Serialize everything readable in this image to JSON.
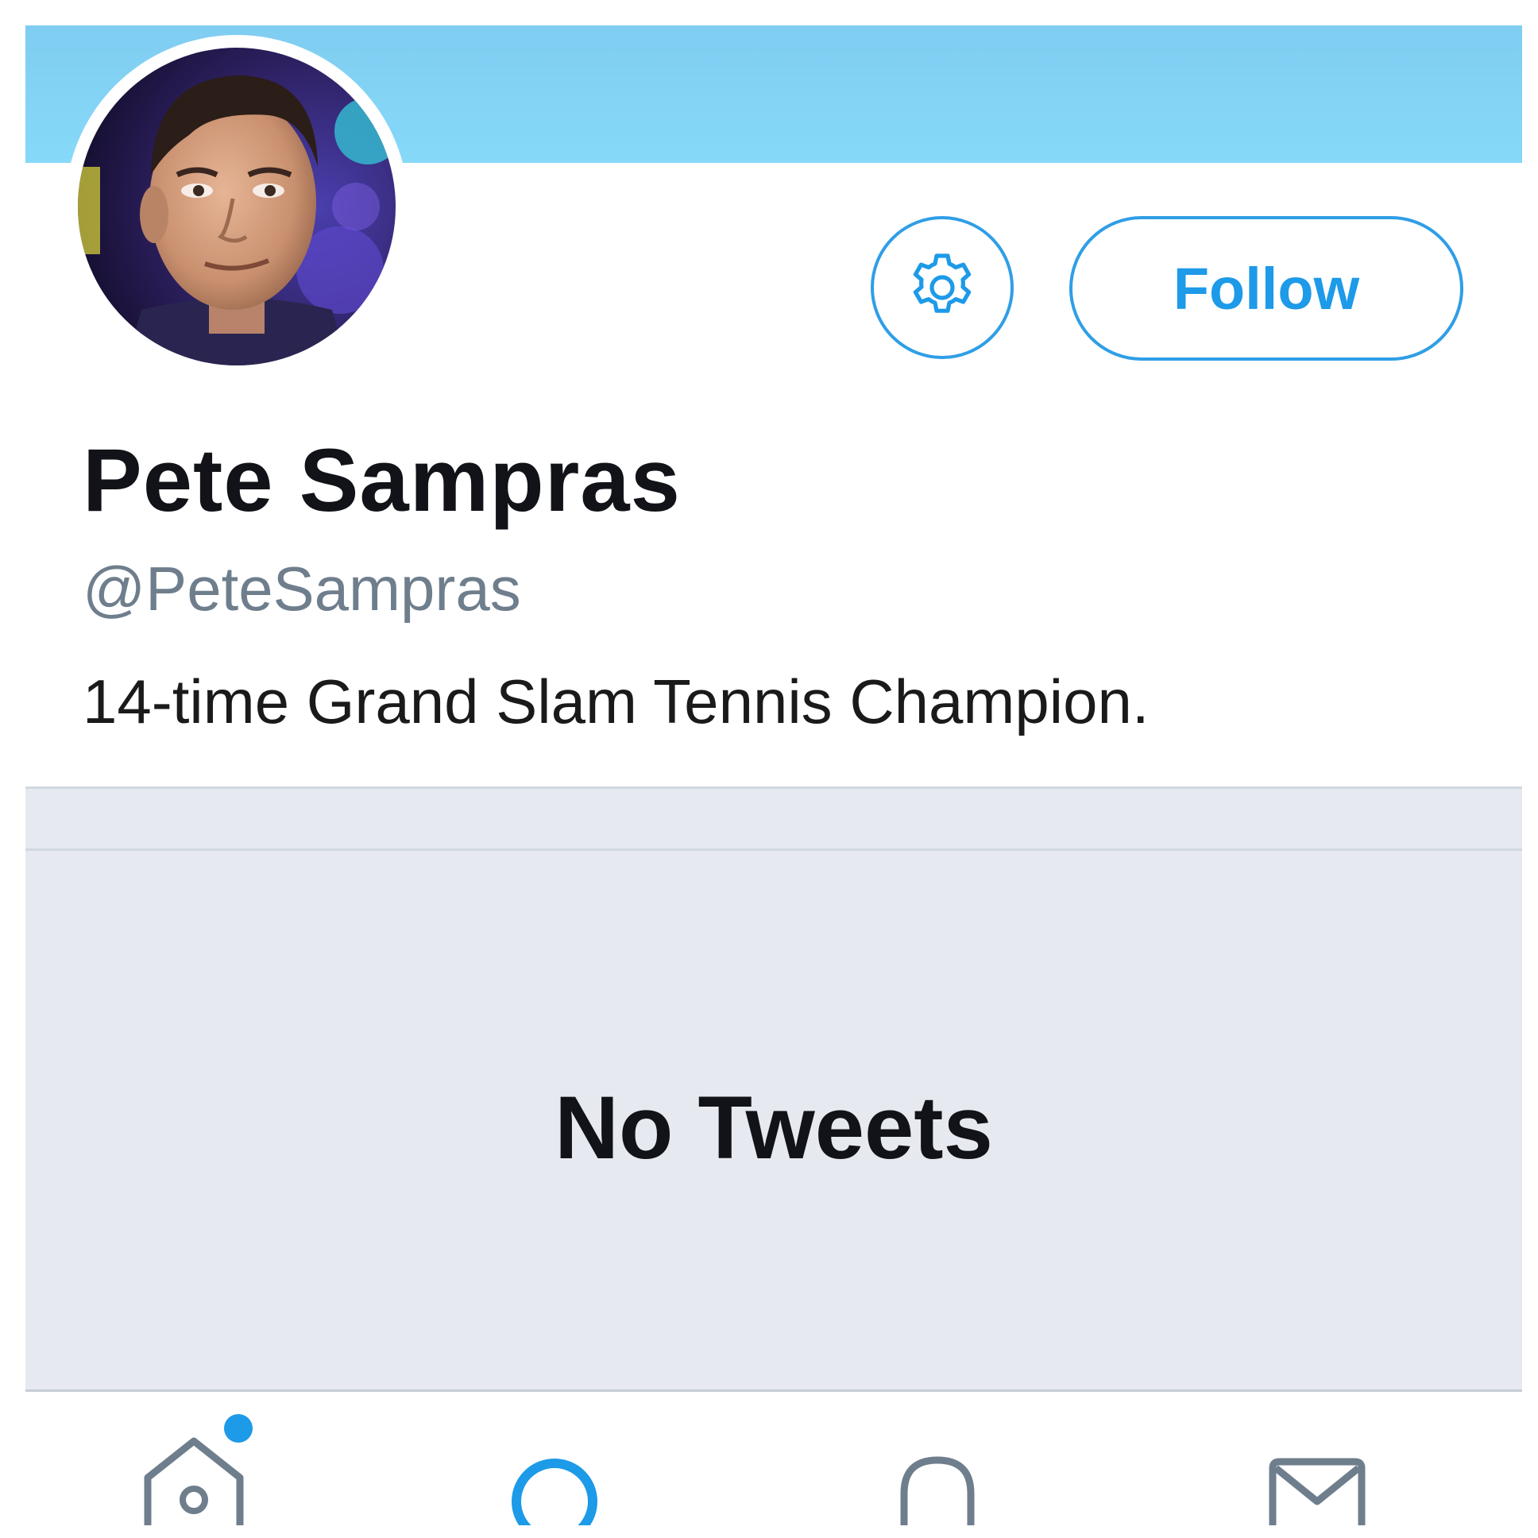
{
  "profile": {
    "name": "Pete Sampras",
    "handle": "@PeteSampras",
    "bio": "14-time Grand Slam Tennis Champion."
  },
  "actions": {
    "follow_label": "Follow",
    "settings_icon": "gear-icon"
  },
  "timeline": {
    "empty_label": "No Tweets"
  },
  "tabbar": {
    "items": [
      {
        "icon": "home-icon",
        "has_notification_dot": true
      },
      {
        "icon": "search-icon"
      },
      {
        "icon": "bell-icon"
      },
      {
        "icon": "mail-icon"
      }
    ]
  },
  "colors": {
    "accent": "#1d9ae8",
    "banner": "#86d9f8",
    "timeline_bg": "#e6eaf0",
    "handle_gray": "#6f7e8c",
    "text_dark": "#111318"
  }
}
